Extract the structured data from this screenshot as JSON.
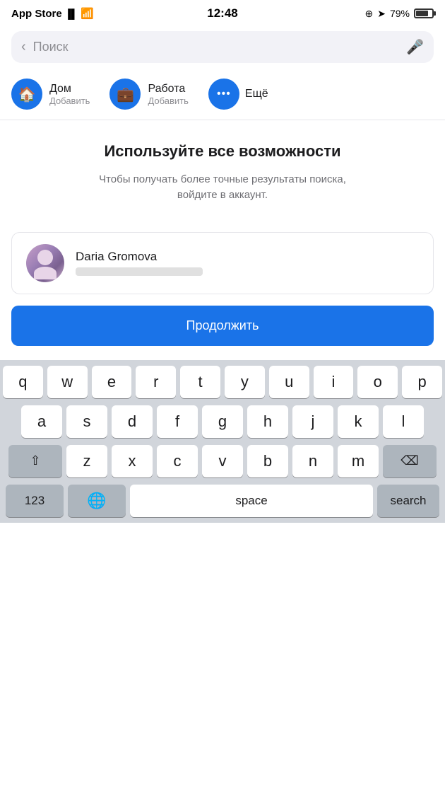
{
  "statusBar": {
    "carrier": "App Store",
    "time": "12:48",
    "batteryPercent": "79%"
  },
  "searchBar": {
    "placeholder": "Поиск",
    "backLabel": "‹",
    "micLabel": "🎤"
  },
  "quickAccess": {
    "items": [
      {
        "icon": "🏠",
        "label": "Дом",
        "sub": "Добавить"
      },
      {
        "icon": "💼",
        "label": "Работа",
        "sub": "Добавить"
      }
    ],
    "more": {
      "icon": "···",
      "label": "Ещё"
    }
  },
  "promo": {
    "title": "Используйте все возможности",
    "subtitle": "Чтобы получать более точные результаты поиска,\nвойдите в аккаунт."
  },
  "account": {
    "name": "Daria Gromova",
    "emailMasked": true
  },
  "continueButton": {
    "label": "Продолжить"
  },
  "keyboard": {
    "rows": [
      [
        "q",
        "w",
        "e",
        "r",
        "t",
        "y",
        "u",
        "i",
        "o",
        "p"
      ],
      [
        "a",
        "s",
        "d",
        "f",
        "g",
        "h",
        "j",
        "k",
        "l"
      ],
      [
        "z",
        "x",
        "c",
        "v",
        "b",
        "n",
        "m"
      ]
    ],
    "bottomRow": {
      "num": "123",
      "globe": "🌐",
      "space": "space",
      "search": "search"
    }
  }
}
